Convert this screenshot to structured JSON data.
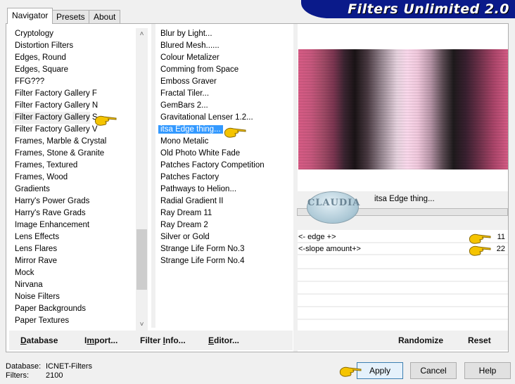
{
  "app": {
    "title": "Filters Unlimited 2.0"
  },
  "tabs": [
    {
      "label": "Navigator",
      "active": true
    },
    {
      "label": "Presets",
      "active": false
    },
    {
      "label": "About",
      "active": false
    }
  ],
  "categories": {
    "items": [
      "Cryptology",
      "Distortion Filters",
      "Edges, Round",
      "Edges, Square",
      "FFG???",
      "Filter Factory Gallery F",
      "Filter Factory Gallery N",
      "Filter Factory Gallery S",
      "Filter Factory Gallery V",
      "Frames, Marble & Crystal",
      "Frames, Stone & Granite",
      "Frames, Textured",
      "Frames, Wood",
      "Gradients",
      "Harry's Power Grads",
      "Harry's Rave Grads",
      "Image Enhancement",
      "Lens Effects",
      "Lens Flares",
      "Mirror Rave",
      "Mock",
      "Nirvana",
      "Noise Filters",
      "Paper Backgrounds",
      "Paper Textures"
    ],
    "selected": "Filter Factory Gallery S"
  },
  "filters": {
    "items": [
      "Blur by Light...",
      "Blured Mesh......",
      "Colour Metalizer",
      "Comming from Space",
      "Emboss Graver",
      "Fractal Tiler...",
      "GemBars 2...",
      "Gravitational Lenser 1.2...",
      "itsa Edge thing...",
      "Mono Metalic",
      "Old Photo White Fade",
      "Patches Factory Competition",
      "Patches Factory",
      "Pathways to Helion...",
      "Radial Gradient II",
      "Ray Dream 11",
      "Ray Dream 2",
      "Silver or Gold",
      "Strange Life Form No.3",
      "Strange Life Form No.4"
    ],
    "selected": "itsa Edge thing..."
  },
  "filter_info": {
    "logo_text": "CLAUDIA",
    "name": "itsa Edge thing..."
  },
  "params": [
    {
      "label": "<- edge +>",
      "value": "11"
    },
    {
      "label": "<-slope amount+>",
      "value": "22"
    }
  ],
  "left_buttons": {
    "database": {
      "pre": "",
      "u": "D",
      "post": "atabase"
    },
    "import": {
      "pre": "I",
      "u": "m",
      "post": "port..."
    },
    "filter_info": {
      "pre": "Filter ",
      "u": "I",
      "post": "nfo..."
    },
    "editor": {
      "pre": "",
      "u": "E",
      "post": "ditor..."
    }
  },
  "right_buttons": {
    "randomize": "Randomize",
    "reset": "Reset"
  },
  "status": {
    "database_label": "Database:",
    "database_value": "ICNET-Filters",
    "filters_label": "Filters:",
    "filters_value": "2100"
  },
  "dialog_buttons": {
    "apply": "Apply",
    "cancel": "Cancel",
    "help": "Help"
  },
  "colors": {
    "banner": "#0a1a8a",
    "selection": "#3399ff",
    "hand": "#f5c400"
  }
}
